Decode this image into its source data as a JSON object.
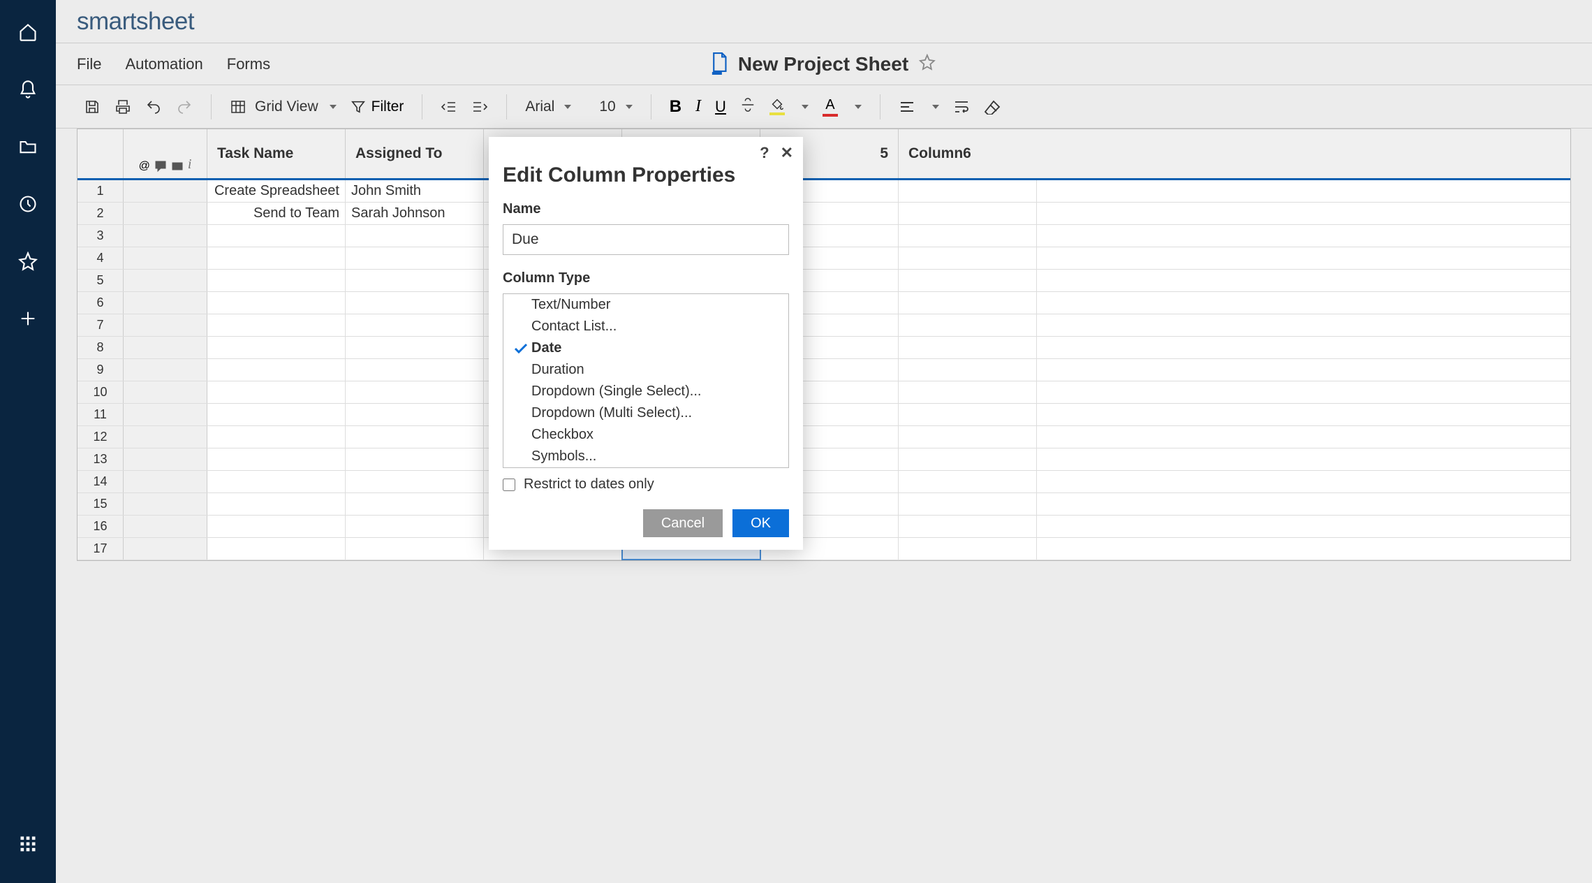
{
  "logo": "smartsheet",
  "menubar": {
    "file": "File",
    "automation": "Automation",
    "forms": "Forms"
  },
  "sheet": {
    "title": "New Project Sheet"
  },
  "toolbar": {
    "view_label": "Grid View",
    "filter_label": "Filter",
    "font_name": "Arial",
    "font_size": "10"
  },
  "columns": [
    "Task Name",
    "Assigned To",
    "",
    "",
    "5",
    "Column6"
  ],
  "rows": [
    {
      "num": "1",
      "cells": [
        "Create Spreadsheet",
        "John Smith",
        "",
        "",
        "",
        ""
      ]
    },
    {
      "num": "2",
      "cells": [
        "Send to Team",
        "Sarah Johnson",
        "",
        "",
        "",
        ""
      ]
    },
    {
      "num": "3",
      "cells": [
        "",
        "",
        "",
        "",
        "",
        ""
      ]
    },
    {
      "num": "4",
      "cells": [
        "",
        "",
        "",
        "",
        "",
        ""
      ]
    },
    {
      "num": "5",
      "cells": [
        "",
        "",
        "",
        "",
        "",
        ""
      ]
    },
    {
      "num": "6",
      "cells": [
        "",
        "",
        "",
        "",
        "",
        ""
      ]
    },
    {
      "num": "7",
      "cells": [
        "",
        "",
        "",
        "",
        "",
        ""
      ]
    },
    {
      "num": "8",
      "cells": [
        "",
        "",
        "",
        "",
        "",
        ""
      ]
    },
    {
      "num": "9",
      "cells": [
        "",
        "",
        "",
        "",
        "",
        ""
      ]
    },
    {
      "num": "10",
      "cells": [
        "",
        "",
        "",
        "",
        "",
        ""
      ]
    },
    {
      "num": "11",
      "cells": [
        "",
        "",
        "",
        "",
        "",
        ""
      ]
    },
    {
      "num": "12",
      "cells": [
        "",
        "",
        "",
        "",
        "",
        ""
      ]
    },
    {
      "num": "13",
      "cells": [
        "",
        "",
        "",
        "",
        "",
        ""
      ]
    },
    {
      "num": "14",
      "cells": [
        "",
        "",
        "",
        "",
        "",
        ""
      ]
    },
    {
      "num": "15",
      "cells": [
        "",
        "",
        "",
        "",
        "",
        ""
      ]
    },
    {
      "num": "16",
      "cells": [
        "",
        "",
        "",
        "",
        "",
        ""
      ]
    },
    {
      "num": "17",
      "cells": [
        "",
        "",
        "",
        "",
        "",
        ""
      ]
    }
  ],
  "dialog": {
    "title": "Edit Column Properties",
    "name_label": "Name",
    "name_value": "Due",
    "type_label": "Column Type",
    "types": [
      "Text/Number",
      "Contact List...",
      "Date",
      "Duration",
      "Dropdown (Single Select)...",
      "Dropdown (Multi Select)...",
      "Checkbox",
      "Symbols..."
    ],
    "selected_type_index": 2,
    "restrict_label": "Restrict to dates only",
    "cancel": "Cancel",
    "ok": "OK"
  },
  "selected_cell": {
    "row": 16,
    "col": 3
  }
}
